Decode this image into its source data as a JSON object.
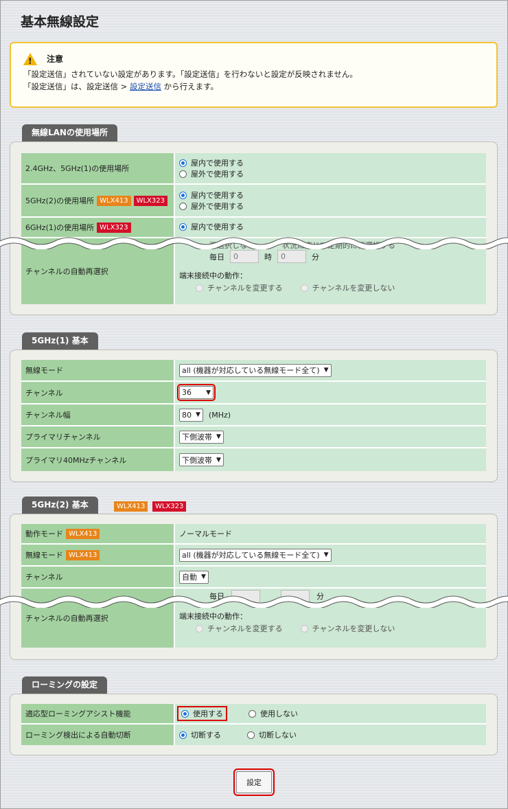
{
  "page_title": "基本無線設定",
  "notice": {
    "title": "注意",
    "line1": "「設定送信」されていない設定があります。「設定送信」を行わないと設定が反映されません。",
    "line2_prefix": "「設定送信」は、設定送信 > ",
    "line2_link": "設定送信",
    "line2_suffix": " から行えます。"
  },
  "badges": {
    "wlx413": "WLX413",
    "wlx323": "WLX323"
  },
  "section_location": {
    "tab": "無線LANの使用場所",
    "rows": [
      {
        "label": "2.4GHz、5GHz(1)の使用場所",
        "opt1": "屋内で使用する",
        "opt2": "屋外で使用する"
      },
      {
        "label": "5GHz(2)の使用場所",
        "opt1": "屋内で使用する",
        "opt2": "屋外で使用する"
      },
      {
        "label": "6GHz(1)の使用場所",
        "opt1": "屋内で使用する"
      }
    ],
    "auto_reselect": {
      "label": "チャンネルの自動再選択",
      "partial1": "再選択しない",
      "partial2": "状況に応じて定期的に再選択する",
      "daily": "毎日",
      "hour_value": "0",
      "hour_unit": "時",
      "min_value": "0",
      "min_unit": "分",
      "behavior_label": "端末接続中の動作：",
      "opt_change": "チャンネルを変更する",
      "opt_nochange": "チャンネルを変更しない"
    }
  },
  "section_5g1": {
    "tab": "5GHz(1) 基本",
    "mode_label": "無線モード",
    "mode_value": "all (機器が対応している無線モード全て)",
    "channel_label": "チャンネル",
    "channel_value": "36",
    "width_label": "チャンネル幅",
    "width_value": "80",
    "width_unit": "(MHz)",
    "primary_label": "プライマリチャンネル",
    "primary_value": "下側波帯",
    "primary40_label": "プライマリ40MHzチャンネル",
    "primary40_value": "下側波帯"
  },
  "section_5g2": {
    "tab": "5GHz(2) 基本",
    "op_mode_label": "動作モード",
    "op_mode_value": "ノーマルモード",
    "mode_label": "無線モード",
    "mode_value": "all (機器が対応している無線モード全て)",
    "channel_label": "チャンネル",
    "channel_value": "自動",
    "auto_reselect_label": "チャンネルの自動再選択",
    "partial_daily": "毎日",
    "partial_min": "分",
    "behavior_label": "端末接続中の動作：",
    "opt_change": "チャンネルを変更する",
    "opt_nochange": "チャンネルを変更しない"
  },
  "section_roaming": {
    "tab": "ローミングの設定",
    "assist_label": "適応型ローミングアシスト機能",
    "assist_on": "使用する",
    "assist_off": "使用しない",
    "cut_label": "ローミング検出による自動切断",
    "cut_on": "切断する",
    "cut_off": "切断しない"
  },
  "submit_label": "設定"
}
